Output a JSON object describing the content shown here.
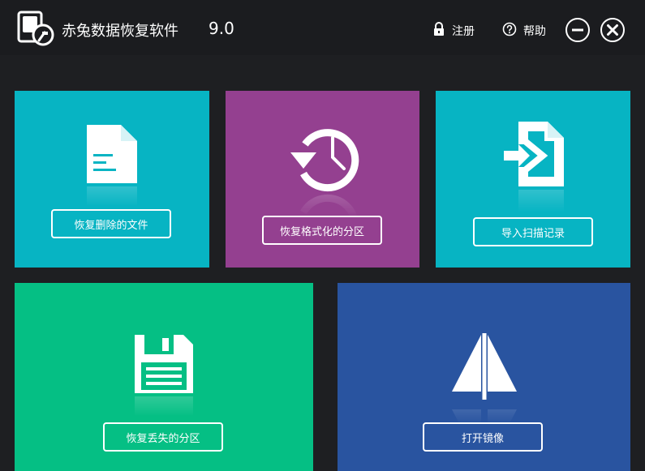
{
  "window": {
    "title": "赤兔数据恢复软件",
    "version": "9.0",
    "register_label": "注册",
    "help_label": "帮助"
  },
  "tiles": {
    "recover_files": {
      "label": "恢复删除的文件",
      "icon": "document-icon",
      "color": "#07b4c3"
    },
    "recover_formatted": {
      "label": "恢复格式化的分区",
      "icon": "history-clock-icon",
      "color": "#944090"
    },
    "import_scan": {
      "label": "导入扫描记录",
      "icon": "import-file-icon",
      "color": "#07b4c3"
    },
    "recover_lost": {
      "label": "恢复丢失的分区",
      "icon": "floppy-disk-icon",
      "color": "#05bf84"
    },
    "open_image": {
      "label": "打开镜像",
      "icon": "sail-icon",
      "color": "#2954a0"
    }
  }
}
